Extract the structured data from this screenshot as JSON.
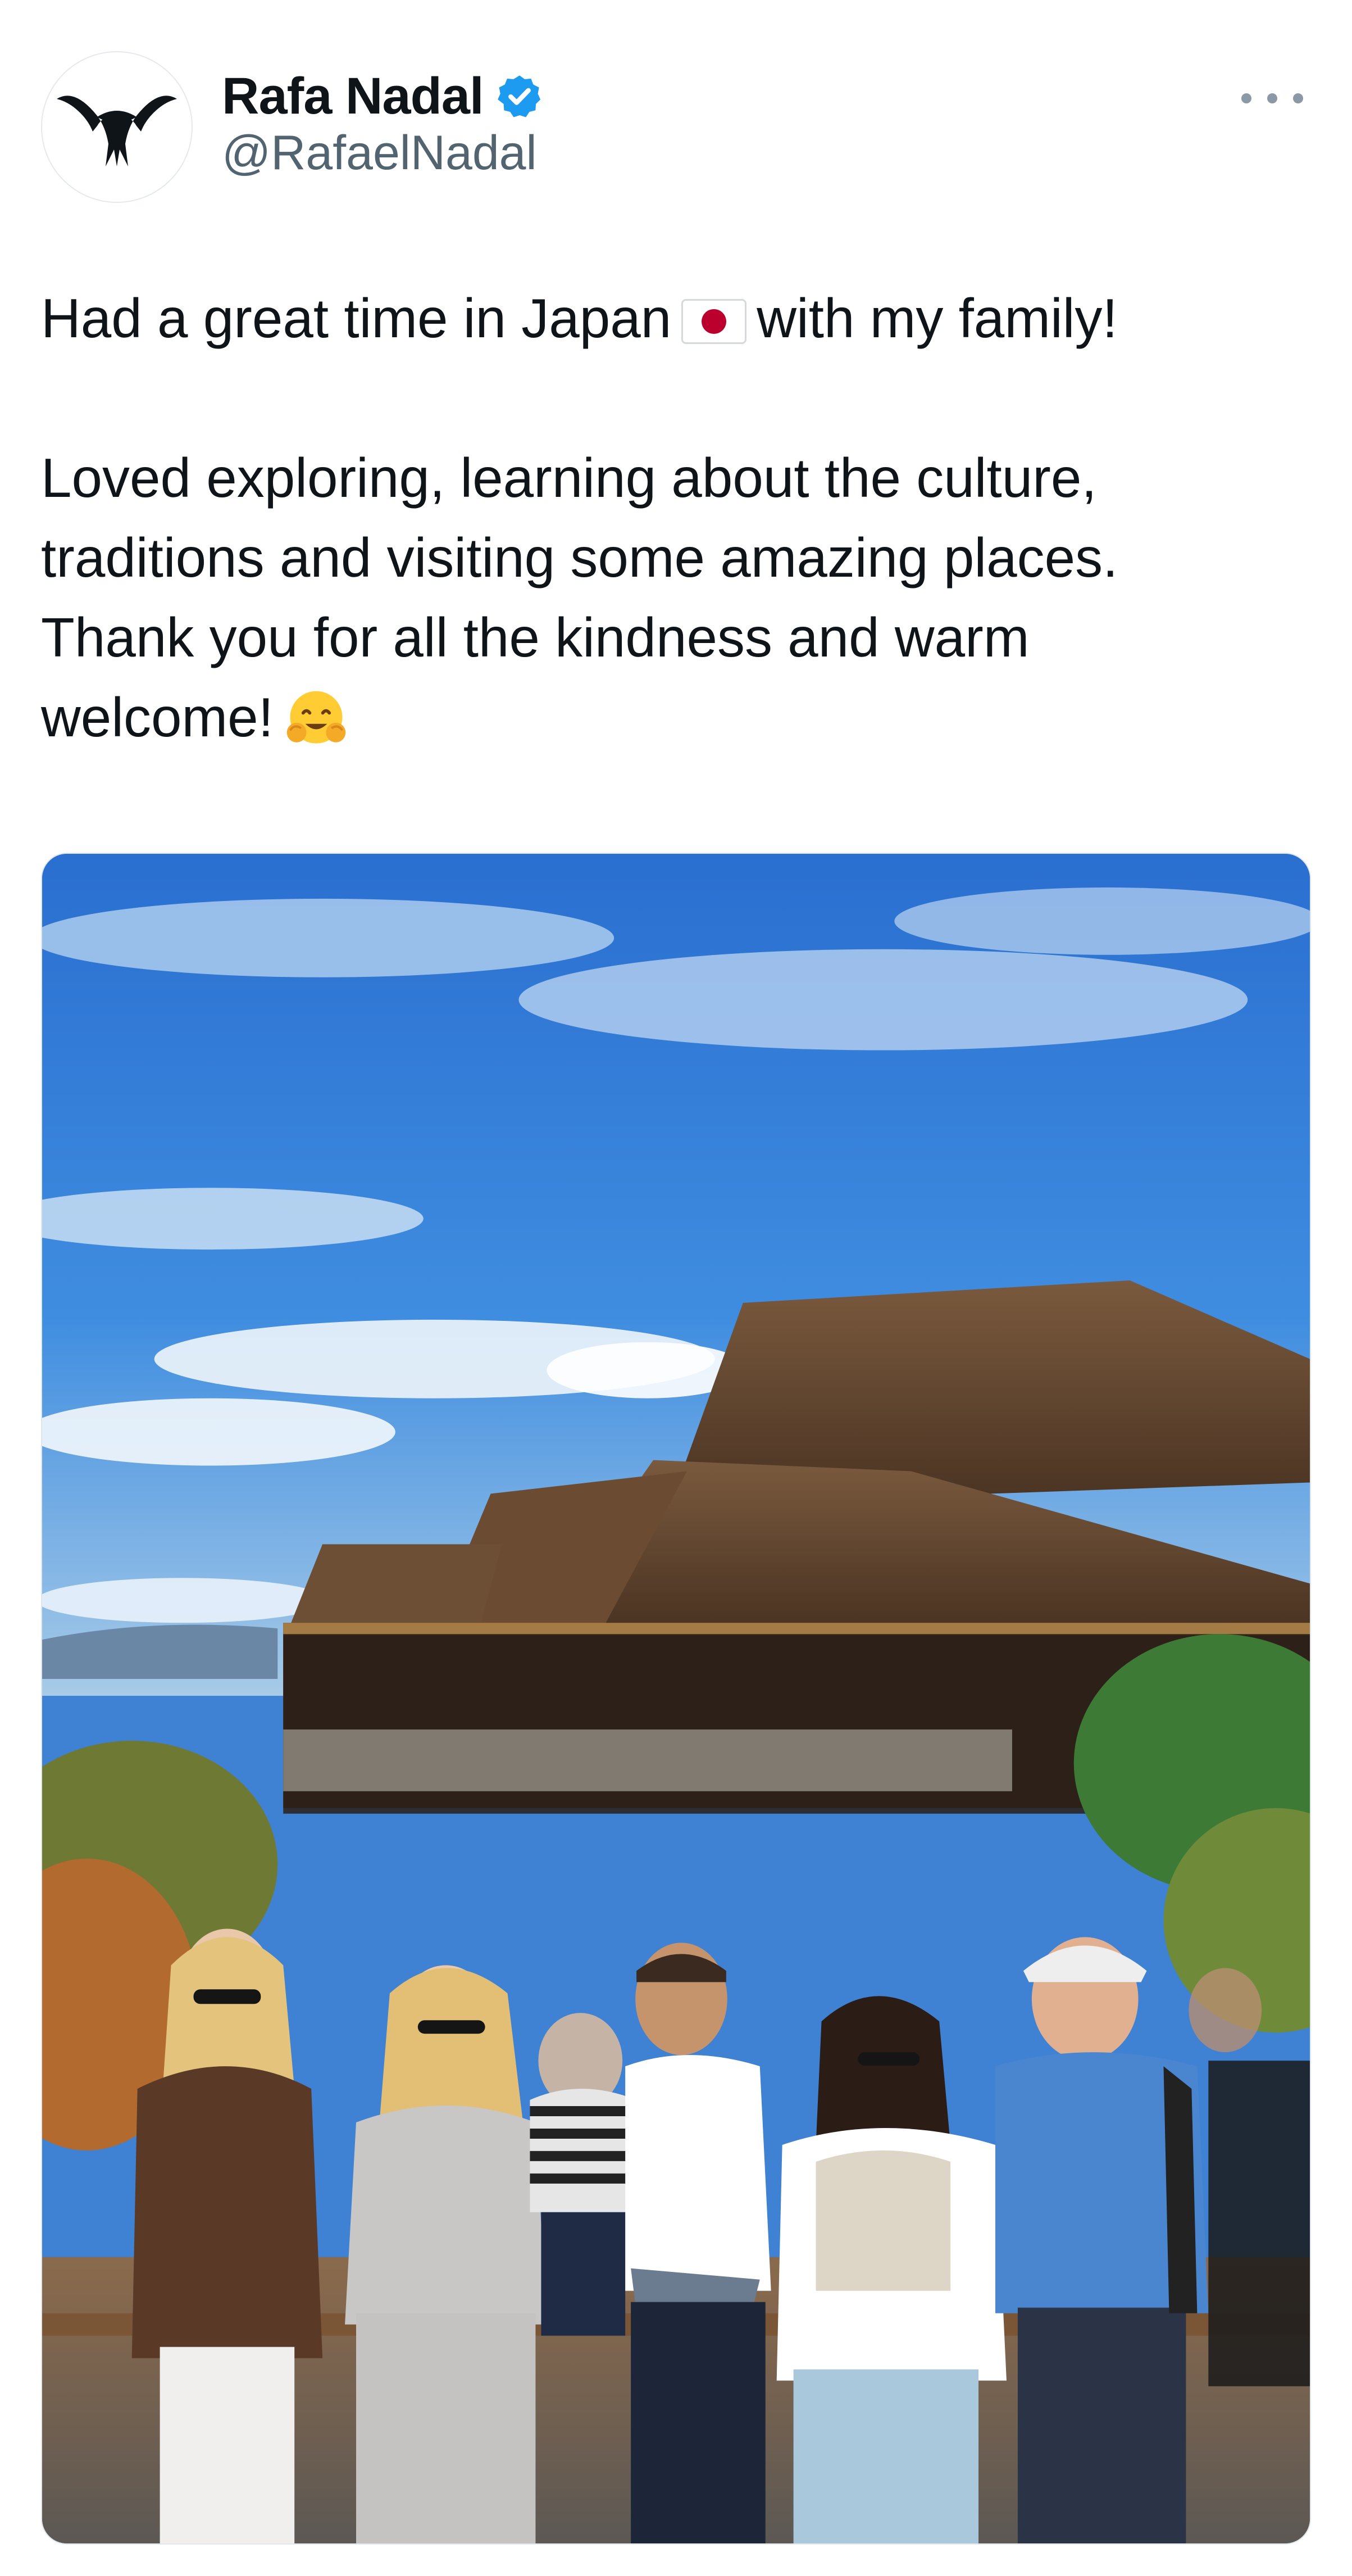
{
  "author": {
    "display_name": "Rafa Nadal",
    "handle": "@RafaelNadal",
    "verified_badge": "verified-badge-icon",
    "avatar_icon": "bull-logo-icon"
  },
  "menu": {
    "icon": "more-options-icon"
  },
  "tweet": {
    "line1_before_flag": "Had a great time in Japan",
    "flag_emoji": "japan-flag-icon",
    "line1_after_flag": "with my family!",
    "line2": "Loved exploring, learning about the culture,",
    "line3": "traditions and visiting some amazing places.",
    "line4": "Thank you for all the kindness and warm",
    "line5": "welcome!",
    "closing_emoji": "hugging-face-icon"
  },
  "media": {
    "type": "photo",
    "icon": "family-photo-at-temple"
  },
  "colors": {
    "text_primary": "#0f1419",
    "text_secondary": "#536471",
    "verified_blue": "#1d9bf0",
    "flag_red": "#bc002d"
  }
}
